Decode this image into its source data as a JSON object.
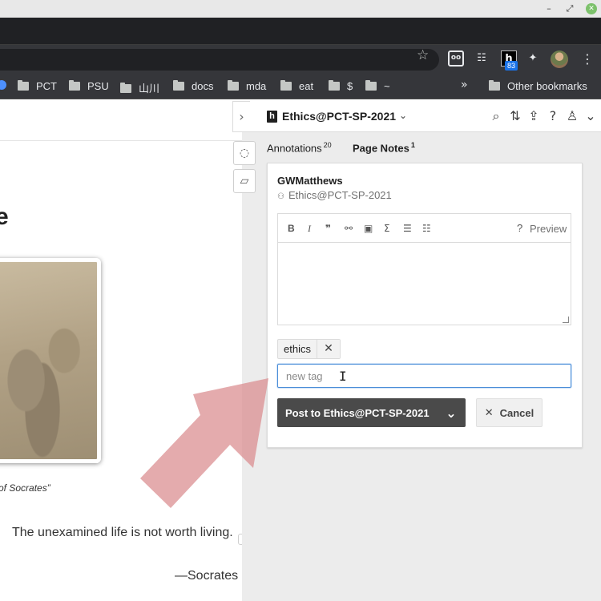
{
  "browser": {
    "window_controls": {
      "minimize": "–",
      "restore": "⤢",
      "close": "✕"
    },
    "extensions": [
      {
        "name": "reader-extension-icon",
        "glyph": "oo"
      },
      {
        "name": "list-extension-icon",
        "glyph": "☷"
      },
      {
        "name": "hypothesis-extension-icon",
        "glyph": "h",
        "badge": "83"
      },
      {
        "name": "puzzle-extensions-icon",
        "glyph": "✦"
      }
    ],
    "bookmarks": [
      "PCT",
      "PSU",
      "山川",
      "docs",
      "mda",
      "eat",
      "$",
      "~"
    ],
    "bookmarks_more": "»",
    "other_bookmarks": "Other bookmarks"
  },
  "page": {
    "title": "e",
    "caption": "of Socrates”",
    "quote": "The unexamined life is not worth living.",
    "quote_author": "—Socrates",
    "annotation_count": "1"
  },
  "sidebar": {
    "group": "Ethics@PCT-SP-2021",
    "tabs": [
      {
        "label": "Annotations",
        "count": "20"
      },
      {
        "label": "Page Notes",
        "count": "1"
      }
    ],
    "card": {
      "user": "GWMatthews",
      "group": "Ethics@PCT-SP-2021",
      "editor": {
        "help": "?",
        "preview": "Preview",
        "text": ""
      },
      "tags": [
        "ethics"
      ],
      "new_tag_placeholder": "new tag",
      "post_label": "Post to Ethics@PCT-SP-2021",
      "cancel_label": "Cancel"
    }
  },
  "colors": {
    "post_button": "#4a4a4a",
    "focus_border": "#4b8ed8",
    "arrow": "#d98a8e",
    "sidebar_bg": "#ececec"
  }
}
